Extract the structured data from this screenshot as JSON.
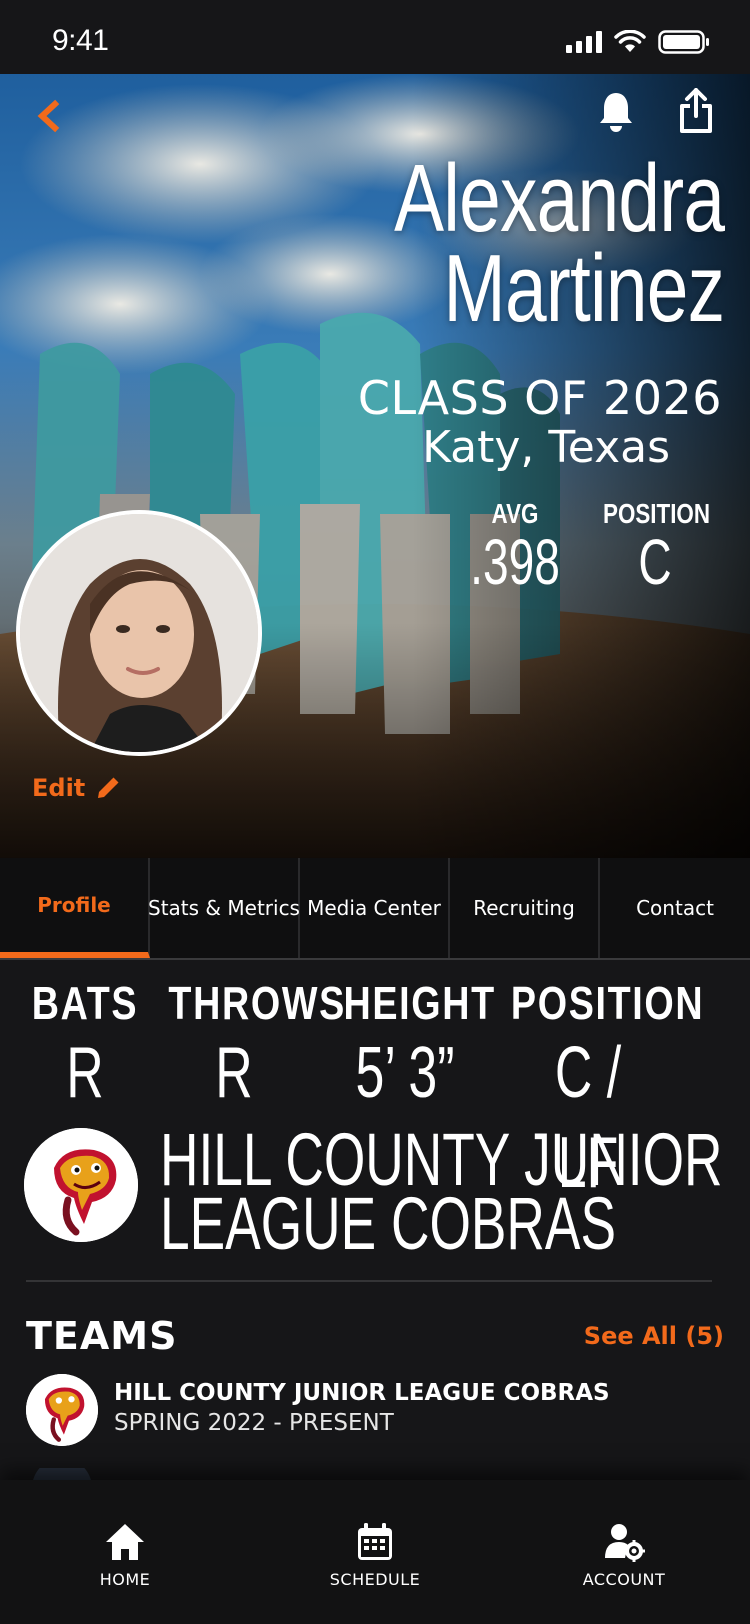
{
  "status_bar": {
    "time": "9:41"
  },
  "hero": {
    "name_line1": "Alexandra",
    "name_line2": "Martinez",
    "class_of": "CLASS OF 2026",
    "hometown": "Katy, Texas",
    "stats": [
      {
        "label": "AVG",
        "value": ".398"
      },
      {
        "label": "POSITION",
        "value": "C"
      }
    ],
    "edit_label": "Edit"
  },
  "tabs": [
    {
      "label": "Profile",
      "active": true
    },
    {
      "label": "Stats & Metrics"
    },
    {
      "label": "Media Center"
    },
    {
      "label": "Recruiting"
    },
    {
      "label": "Contact"
    }
  ],
  "attributes": [
    {
      "label": "BATS",
      "value": "R"
    },
    {
      "label": "THROWS",
      "value": "R"
    },
    {
      "label": "HEIGHT",
      "value": "5’ 3”"
    },
    {
      "label": "POSITION",
      "value": "C / LF"
    }
  ],
  "current_team": {
    "line1": "HILL COUNTY JUNIOR",
    "line2": "LEAGUE COBRAS"
  },
  "teams": {
    "title": "TEAMS",
    "see_all": "See All (5)",
    "items": [
      {
        "name": "HILL COUNTY JUNIOR LEAGUE COBRAS",
        "dates": "SPRING 2022 - PRESENT"
      }
    ]
  },
  "bottom_nav": [
    {
      "label": "HOME",
      "icon": "home-icon"
    },
    {
      "label": "SCHEDULE",
      "icon": "calendar-icon"
    },
    {
      "label": "ACCOUNT",
      "icon": "account-settings-icon"
    }
  ],
  "colors": {
    "accent": "#f26a1b",
    "background": "#161618",
    "tab_bar": "#0f0f10"
  }
}
